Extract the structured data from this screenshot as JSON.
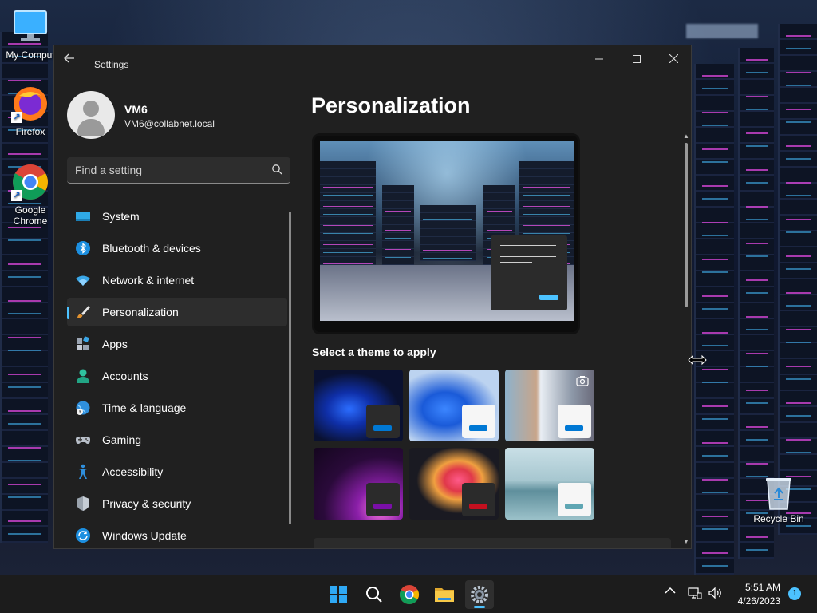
{
  "desktop": {
    "icons": [
      {
        "label": "My Comput",
        "icon": "monitor-icon"
      },
      {
        "label": "Firefox",
        "icon": "firefox-icon"
      },
      {
        "label": "Google Chrome",
        "icon": "chrome-icon"
      },
      {
        "label": "Recycle Bin",
        "icon": "recycle-bin-icon"
      }
    ]
  },
  "window": {
    "title": "Settings",
    "controls": {
      "minimize": "minimize-icon",
      "maximize": "maximize-icon",
      "close": "close-icon"
    }
  },
  "user": {
    "name": "VM6",
    "email": "VM6@collabnet.local"
  },
  "search": {
    "placeholder": "Find a setting"
  },
  "nav": {
    "active": "Personalization",
    "items": [
      {
        "label": "System",
        "icon": "system-icon"
      },
      {
        "label": "Bluetooth & devices",
        "icon": "bluetooth-icon"
      },
      {
        "label": "Network & internet",
        "icon": "wifi-icon"
      },
      {
        "label": "Personalization",
        "icon": "brush-icon"
      },
      {
        "label": "Apps",
        "icon": "apps-icon"
      },
      {
        "label": "Accounts",
        "icon": "accounts-icon"
      },
      {
        "label": "Time & language",
        "icon": "globe-clock-icon"
      },
      {
        "label": "Gaming",
        "icon": "gamepad-icon"
      },
      {
        "label": "Accessibility",
        "icon": "accessibility-icon"
      },
      {
        "label": "Privacy & security",
        "icon": "shield-icon"
      },
      {
        "label": "Windows Update",
        "icon": "update-icon"
      }
    ]
  },
  "main": {
    "title": "Personalization",
    "section_label": "Select a theme to apply",
    "themes": [
      {
        "name": "windows-dark",
        "accent": "#0078d4"
      },
      {
        "name": "windows-light",
        "accent": "#0078d4"
      },
      {
        "name": "captured-motion",
        "accent": "#0078d4"
      },
      {
        "name": "glow",
        "accent": "#7a0fa8"
      },
      {
        "name": "sunrise",
        "accent": "#c4101f"
      },
      {
        "name": "flow",
        "accent": "#5fa6b3"
      }
    ]
  },
  "taskbar": {
    "apps": [
      "start-icon",
      "search-icon",
      "chrome-icon",
      "file-explorer-icon",
      "settings-icon"
    ],
    "time": "5:51 AM",
    "date": "4/26/2023",
    "notification_count": "1"
  },
  "colors": {
    "accent": "#4cc2ff",
    "window_bg": "#202020",
    "panel_bg": "#2d2d2d"
  }
}
